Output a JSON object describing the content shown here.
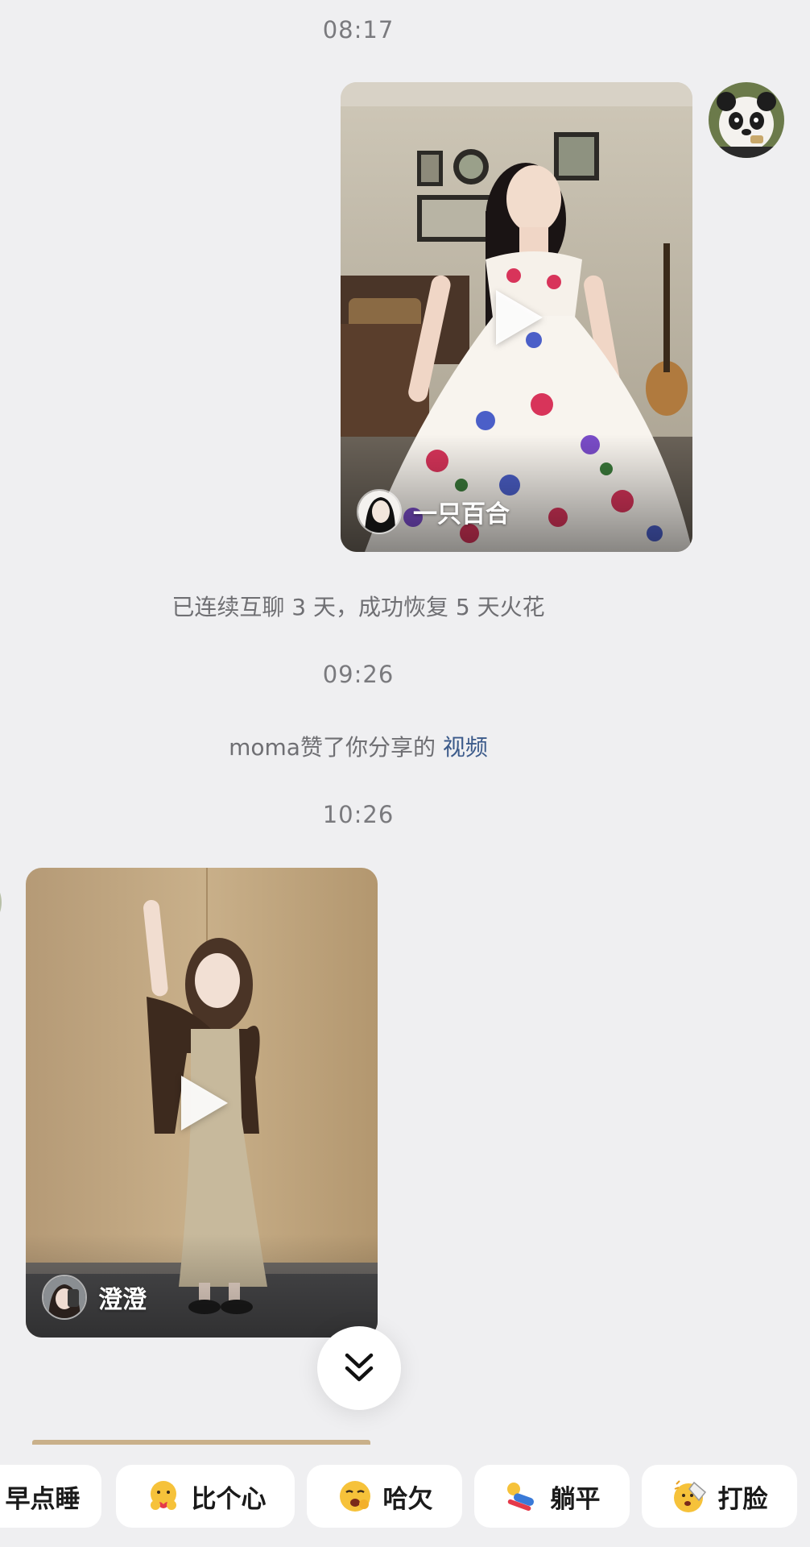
{
  "messages": [
    {
      "type": "timestamp",
      "text": "08:17"
    },
    {
      "type": "video",
      "side": "right",
      "author": "一只百合"
    },
    {
      "type": "system",
      "text": "已连续互聊 3 天，成功恢复 5 天火花"
    },
    {
      "type": "timestamp",
      "text": "09:26"
    },
    {
      "type": "like_notice",
      "prefix": "moma赞了你分享的 ",
      "link": "视频"
    },
    {
      "type": "timestamp",
      "text": "10:26"
    },
    {
      "type": "video",
      "side": "left",
      "author": "澄澄"
    }
  ],
  "scroll_button_icon": "double-chevron-down-icon",
  "quick_replies": [
    {
      "label": "早点睡",
      "icon": ""
    },
    {
      "label": "比个心",
      "icon": "heart-hands-emoji-icon"
    },
    {
      "label": "哈欠",
      "icon": "yawn-emoji-icon"
    },
    {
      "label": "躺平",
      "icon": "lie-flat-emoji-icon"
    },
    {
      "label": "打脸",
      "icon": "face-slap-emoji-icon"
    }
  ],
  "colors": {
    "background": "#efeff1",
    "link": "#3b5a8a",
    "chip_background": "#ffffff"
  }
}
